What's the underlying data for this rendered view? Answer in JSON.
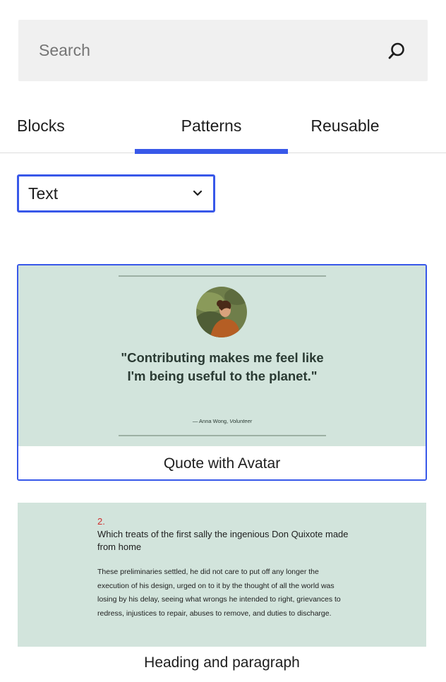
{
  "search": {
    "placeholder": "Search"
  },
  "tabs": [
    {
      "label": "Blocks",
      "active": false
    },
    {
      "label": "Patterns",
      "active": true
    },
    {
      "label": "Reusable",
      "active": false
    }
  ],
  "category_select": {
    "value": "Text"
  },
  "patterns": [
    {
      "label": "Quote with Avatar",
      "quote": "\"Contributing makes me feel like I'm being useful to the planet.\"",
      "citation_name": "— Anna Wong, ",
      "citation_role": "Volunteer"
    },
    {
      "label": "Heading and paragraph",
      "number": "2.",
      "heading": "Which treats of the first sally the ingenious Don Quixote made from home",
      "paragraph": "These preliminaries settled, he did not care to put off any longer the execution of his design, urged on to it by the thought of all the world was losing by his delay, seeing what wrongs he intended to right, grievances to redress, injustices to repair, abuses to remove, and duties to discharge."
    }
  ],
  "colors": {
    "accent": "#3858e9",
    "preview_bg": "#d2e4dc",
    "search_bg": "#f0f0f0",
    "number_red": "#cf2e2e"
  },
  "icons": {
    "search": "search-icon",
    "chevron": "chevron-down-icon"
  }
}
